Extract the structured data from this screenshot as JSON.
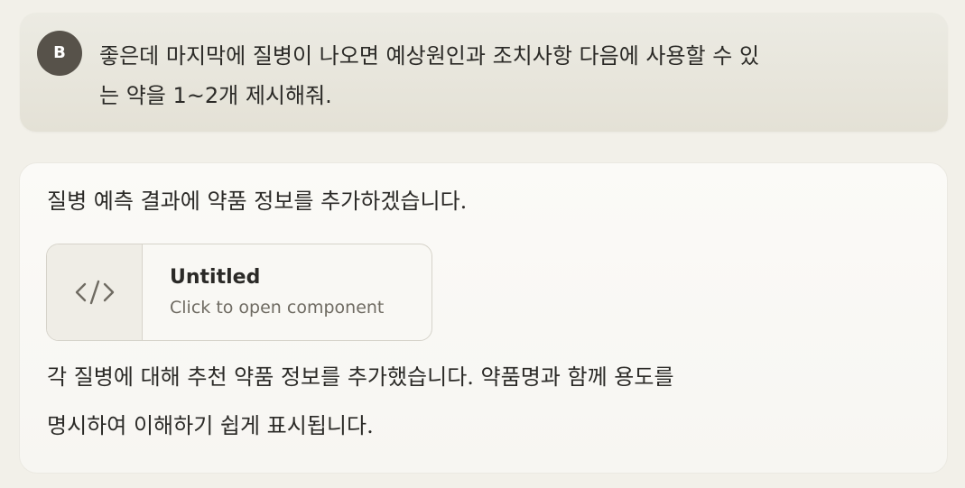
{
  "user_message": {
    "avatar_initial": "B",
    "lines": [
      "좋은데 마지막에 질병이 나오면 예상원인과 조치사항 다음에 사용할 수 있",
      "는 약을 1~2개 제시해줘."
    ]
  },
  "assistant_message": {
    "intro": "질병 예측 결과에 약품 정보를 추가하겠습니다.",
    "artifact": {
      "icon": "code-icon",
      "title": "Untitled",
      "subtitle": "Click to open component"
    },
    "outro_lines": [
      "각 질병에 대해 추천 약품 정보를 추가했습니다. 약품명과 함께 용도를",
      "명시하여 이해하기 쉽게 표시됩니다."
    ]
  },
  "colors": {
    "page_background": "#f2f0e9",
    "user_bubble": "#e8e6dd",
    "avatar": "#57524a",
    "assistant_bubble": "#faf9f6"
  }
}
